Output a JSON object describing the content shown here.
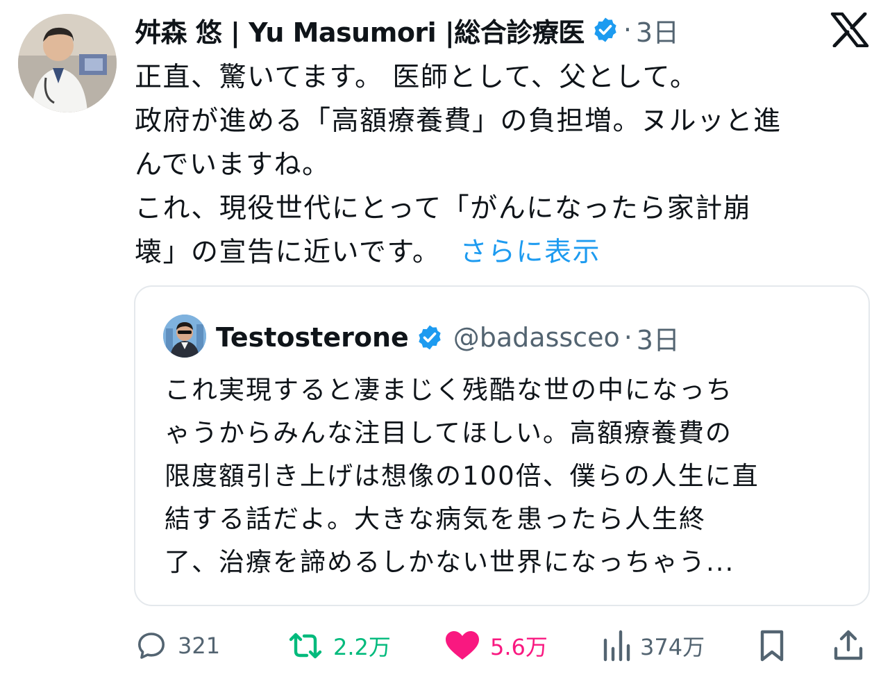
{
  "post": {
    "author_name": "舛森 悠 | Yu Masumori |総合診療医",
    "dot": "·",
    "time": "3日",
    "lines": [
      "正直、驚いてます。 医師として、父として。",
      "政府が進める「高額療養費」の負担増。ヌルッと進",
      "んでいますね。",
      "これ、現役世代にとって「がんになったら家計崩",
      "壊」の宣告に近いです。"
    ],
    "show_more": "さらに表示"
  },
  "quote": {
    "author_name": "Testosterone",
    "handle": "@badassceo",
    "dot": "·",
    "time": "3日",
    "lines": [
      "これ実現すると凄まじく残酷な世の中になっち",
      "ゃうからみんな注目してほしい。高額療養費の",
      "限度額引き上げは想像の100倍、僕らの人生に直",
      "結する話だよ。大きな病気を患ったら人生終",
      "了、治療を諦めるしかない世界になっちゃう..."
    ]
  },
  "actions": {
    "replies": "321",
    "reposts": "2.2万",
    "likes": "5.6万",
    "views": "374万"
  },
  "colors": {
    "text": "#0f1419",
    "muted": "#536471",
    "link": "#1d9bf0",
    "verified": "#1d9bf0",
    "repost": "#00ba7c",
    "like": "#f91880",
    "border": "#e4e8ec"
  },
  "icons": [
    "verified-badge-icon",
    "x-logo-icon",
    "reply-icon",
    "repost-icon",
    "heart-icon",
    "views-icon",
    "bookmark-icon",
    "share-icon"
  ]
}
